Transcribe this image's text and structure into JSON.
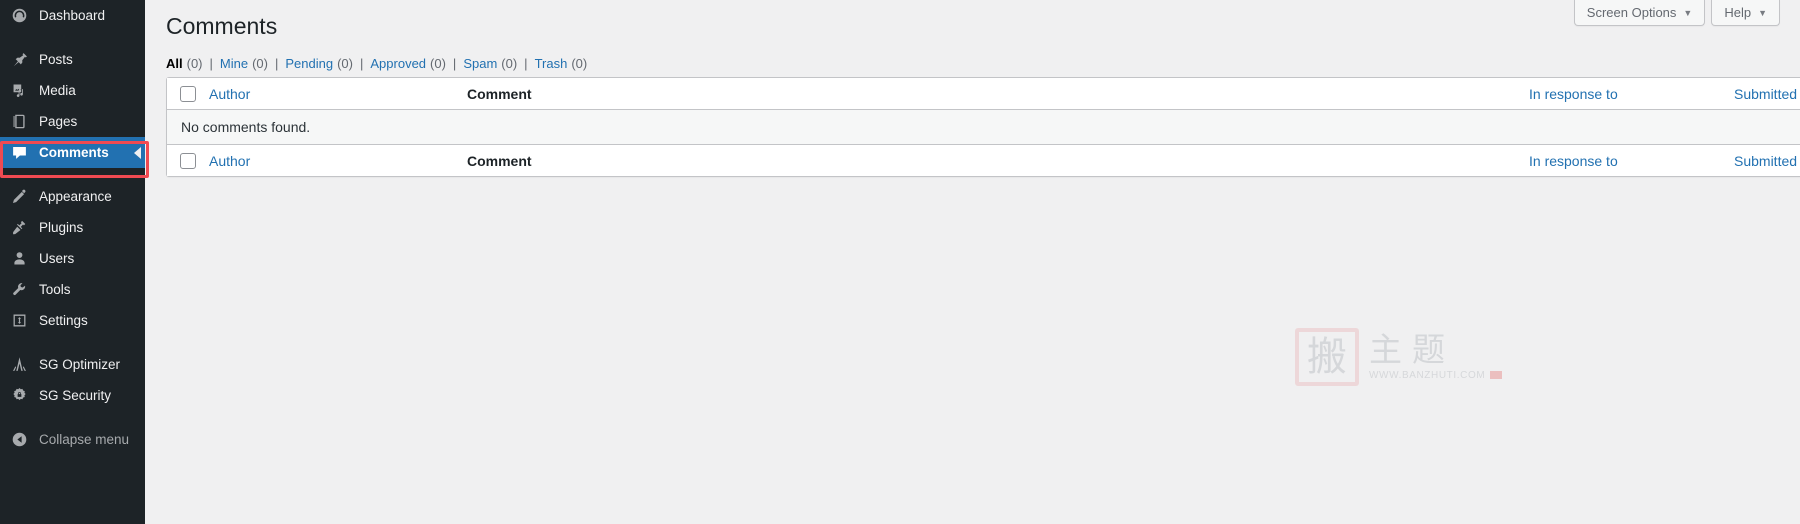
{
  "sidebar": {
    "items": [
      {
        "label": "Dashboard",
        "icon": "dashboard-icon",
        "current": false
      },
      {
        "label": "Posts",
        "icon": "pin-icon",
        "current": false
      },
      {
        "label": "Media",
        "icon": "media-icon",
        "current": false
      },
      {
        "label": "Pages",
        "icon": "pages-icon",
        "current": false
      },
      {
        "label": "Comments",
        "icon": "comments-icon",
        "current": true
      },
      {
        "label": "Appearance",
        "icon": "brush-icon",
        "current": false
      },
      {
        "label": "Plugins",
        "icon": "plugins-icon",
        "current": false
      },
      {
        "label": "Users",
        "icon": "users-icon",
        "current": false
      },
      {
        "label": "Tools",
        "icon": "wrench-icon",
        "current": false
      },
      {
        "label": "Settings",
        "icon": "settings-icon",
        "current": false
      },
      {
        "label": "SG Optimizer",
        "icon": "sg-optimizer-icon",
        "current": false
      },
      {
        "label": "SG Security",
        "icon": "sg-security-icon",
        "current": false
      }
    ],
    "collapse_label": "Collapse menu",
    "collapse_icon": "collapse-arrow-icon",
    "bg_color": "#1d2327",
    "current_bg_color": "#2271b1",
    "highlight_color": "#f04a52"
  },
  "screen_meta": {
    "screen_options_label": "Screen Options",
    "help_label": "Help",
    "caret": "▼"
  },
  "page": {
    "title": "Comments"
  },
  "filters": {
    "separator": "|",
    "items": [
      {
        "label": "All",
        "count": "(0)",
        "current": true
      },
      {
        "label": "Mine",
        "count": "(0)",
        "current": false
      },
      {
        "label": "Pending",
        "count": "(0)",
        "current": false
      },
      {
        "label": "Approved",
        "count": "(0)",
        "current": false
      },
      {
        "label": "Spam",
        "count": "(0)",
        "current": false
      },
      {
        "label": "Trash",
        "count": "(0)",
        "current": false
      }
    ]
  },
  "table": {
    "columns": {
      "author": "Author",
      "comment": "Comment",
      "response": "In response to",
      "submitted": "Submitted on"
    },
    "empty_message": "No comments found."
  },
  "watermark": {
    "seal_char": "搬",
    "chars": "主题",
    "url": "WWW.BANZHUTI.COM"
  }
}
